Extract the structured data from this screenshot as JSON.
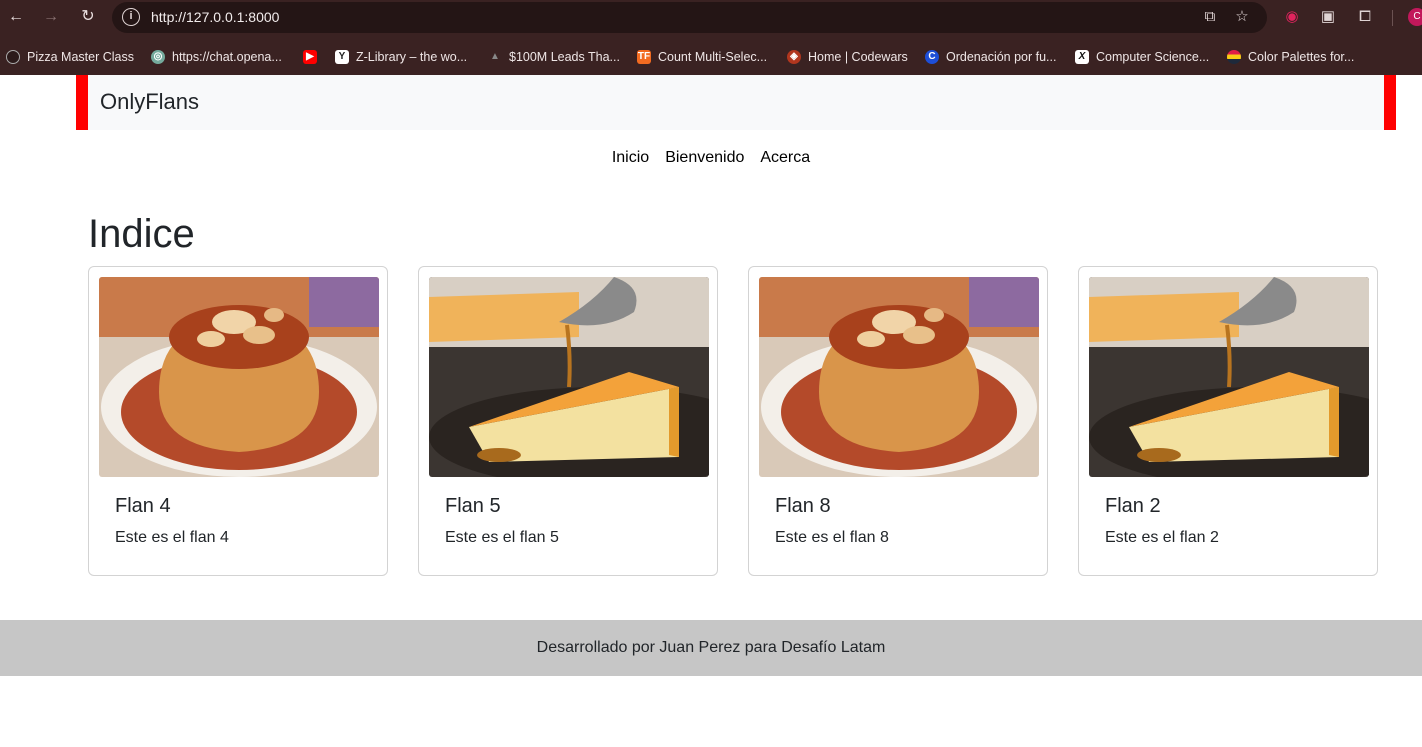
{
  "browser": {
    "url": "http://127.0.0.1:8000",
    "profile_initial": "C",
    "bookmarks": [
      {
        "label": "Pizza Master Class",
        "icon": "pizza-icon"
      },
      {
        "label": "https://chat.opena...",
        "icon": "openai-icon"
      },
      {
        "label": "",
        "icon": "youtube-icon"
      },
      {
        "label": "Z-Library – the wo...",
        "icon": "zlibrary-icon"
      },
      {
        "label": "$100M Leads Tha...",
        "icon": "triangle-icon"
      },
      {
        "label": "Count Multi-Selec...",
        "icon": "tf-icon"
      },
      {
        "label": "Home | Codewars",
        "icon": "codewars-icon"
      },
      {
        "label": "Ordenación por fu...",
        "icon": "c-icon"
      },
      {
        "label": "Computer Science...",
        "icon": "x-icon"
      },
      {
        "label": "Color Palettes for...",
        "icon": "palette-icon"
      }
    ]
  },
  "site": {
    "brand": "OnlyFlans",
    "nav": [
      "Inicio",
      "Bienvenido",
      "Acerca"
    ],
    "heading": "Indice",
    "cards": [
      {
        "title": "Flan 4",
        "text": "Este es el flan 4",
        "image": "round-flan-photo"
      },
      {
        "title": "Flan 5",
        "text": "Este es el flan 5",
        "image": "flan-slice-photo"
      },
      {
        "title": "Flan 8",
        "text": "Este es el flan 8",
        "image": "round-flan-photo"
      },
      {
        "title": "Flan 2",
        "text": "Este es el flan 2",
        "image": "flan-slice-photo"
      }
    ],
    "footer": "Desarrollado por Juan Perez para Desafío Latam"
  },
  "colors": {
    "chrome": "#3a2222",
    "header_accent": "#ff0000",
    "header_bg": "#f8f9fa",
    "footer_bg": "#c6c6c6"
  }
}
